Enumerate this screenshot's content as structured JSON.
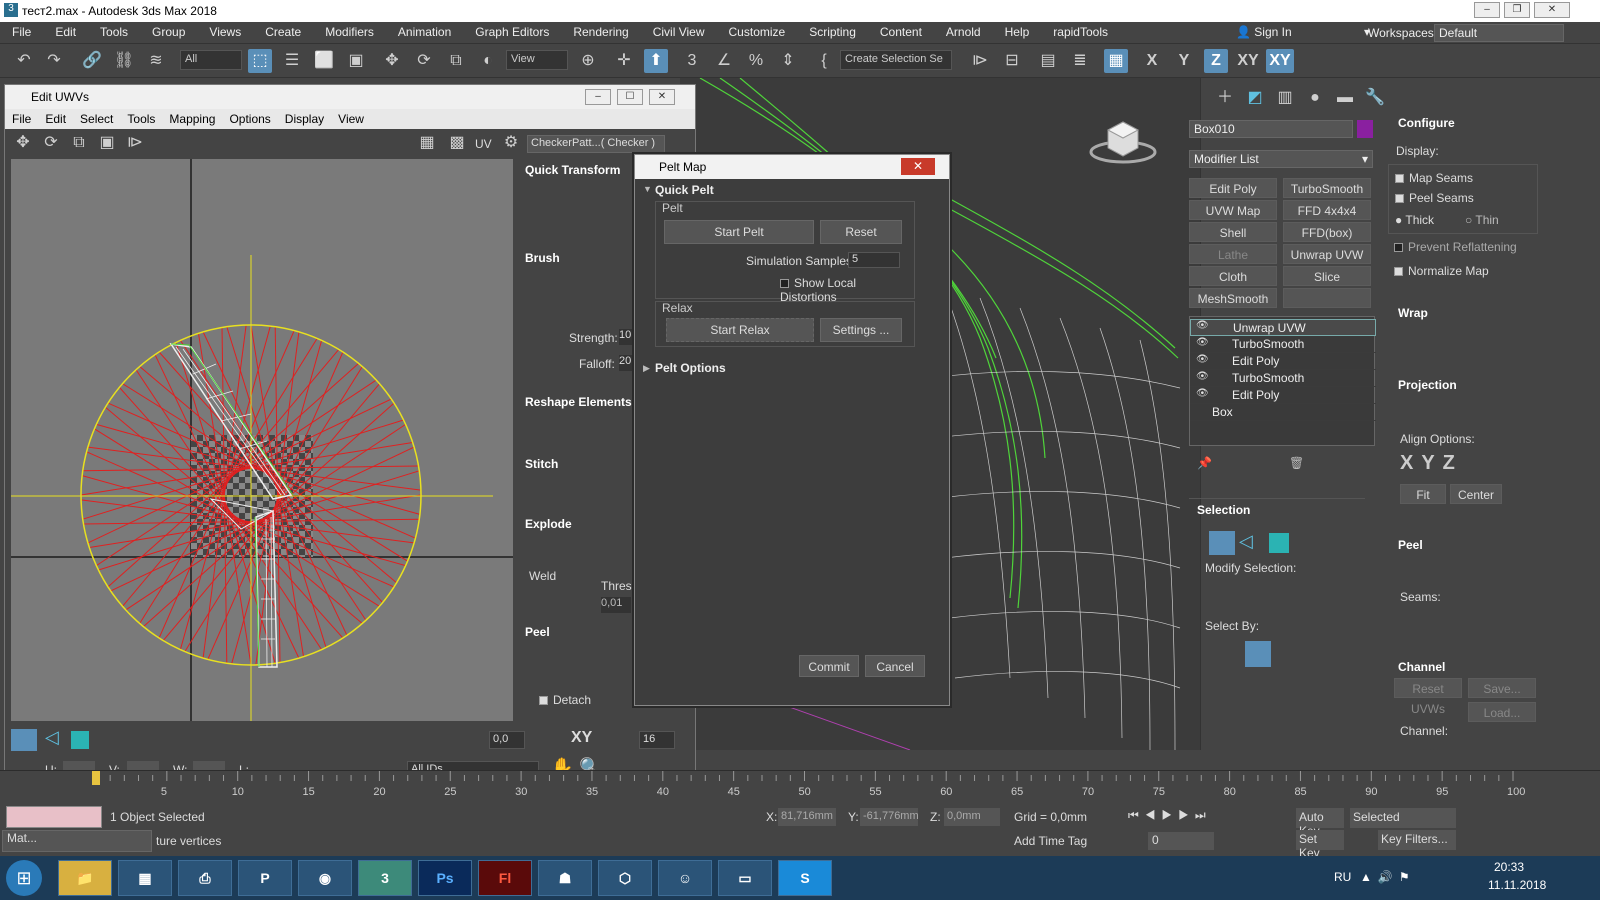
{
  "app": {
    "title": "тест2.max - Autodesk 3ds Max 2018",
    "menu": [
      "File",
      "Edit",
      "Tools",
      "Group",
      "Views",
      "Create",
      "Modifiers",
      "Animation",
      "Graph Editors",
      "Rendering",
      "Civil View",
      "Customize",
      "Scripting",
      "Content",
      "Arnold",
      "Help",
      "rapidTools"
    ],
    "sign_in": "Sign In",
    "workspaces_label": "Workspaces:",
    "workspace": "Default"
  },
  "toolbar": {
    "filter": "All",
    "view": "View",
    "selection_set": "Create Selection Se",
    "axes": [
      "X",
      "Y",
      "Z",
      "XY",
      "XY"
    ]
  },
  "uvw": {
    "title": "Edit UWVs",
    "menu": [
      "File",
      "Edit",
      "Select",
      "Tools",
      "Mapping",
      "Options",
      "Display",
      "View"
    ],
    "uv_label": "UV",
    "checker": "CheckerPatt...( Checker )",
    "sections": {
      "quick_transform": "Quick Transform",
      "brush": "Brush",
      "strength": "Strength:",
      "strength_val": "10",
      "falloff": "Falloff:",
      "falloff_val": "20",
      "reshape": "Reshape Elements",
      "stitch": "Stitch",
      "explode": "Explode",
      "weld": "Weld",
      "thresh": "Thresh",
      "thresh_val": "0,01",
      "peel": "Peel",
      "detach": "Detach"
    },
    "bottom": {
      "angle": "0,0",
      "xy": "XY",
      "count": "16",
      "u": "U:",
      "v": "V:",
      "w": "W:",
      "l": "L:",
      "ids": "All IDs"
    }
  },
  "pelt": {
    "title": "Pelt Map",
    "quick_pelt": "Quick Pelt",
    "pelt_group": "Pelt",
    "start_pelt": "Start Pelt",
    "reset": "Reset",
    "sim_samples_label": "Simulation Samples:",
    "sim_samples": "5",
    "show_distortions": "Show Local Distortions",
    "relax_group": "Relax",
    "start_relax": "Start Relax",
    "settings": "Settings ...",
    "pelt_options": "Pelt Options",
    "commit": "Commit",
    "cancel": "Cancel"
  },
  "cmd": {
    "object_name": "Box010",
    "modifier_list": "Modifier List",
    "buttons": [
      "Edit Poly",
      "TurboSmooth",
      "UVW Map",
      "FFD 4x4x4",
      "Shell",
      "FFD(box)",
      "Lathe",
      "Unwrap UVW",
      "Cloth",
      "Slice",
      "MeshSmooth"
    ],
    "stack": [
      "Unwrap UVW",
      "TurboSmooth",
      "Edit Poly",
      "TurboSmooth",
      "Edit Poly",
      "Box"
    ],
    "selection": "Selection",
    "modify_selection": "Modify Selection:",
    "select_by": "Select By:"
  },
  "configure": {
    "title": "Configure",
    "display": "Display:",
    "map_seams": "Map Seams",
    "peel_seams": "Peel Seams",
    "thick": "Thick",
    "thin": "Thin",
    "prevent": "Prevent Reflattening",
    "normalize": "Normalize Map",
    "wrap": "Wrap",
    "projection": "Projection",
    "align": "Align Options:",
    "fit": "Fit",
    "center": "Center",
    "peel": "Peel",
    "seams": "Seams:",
    "channel": "Channel",
    "reset_uvws": "Reset UVWs",
    "save": "Save...",
    "load": "Load...",
    "channel_label": "Channel:"
  },
  "timeline": {
    "ticks": [
      "5",
      "10",
      "15",
      "20",
      "25",
      "30",
      "35",
      "40",
      "45",
      "50",
      "55",
      "60",
      "65",
      "70",
      "75",
      "80",
      "85",
      "90",
      "95",
      "100"
    ]
  },
  "status": {
    "selected": "1 Object Selected",
    "x": "81,716mm",
    "y": "-61,776mm",
    "z": "0,0mm",
    "grid": "Grid = 0,0mm",
    "autokey": "Auto Key",
    "setkey": "Set Key",
    "sel_mode": "Selected",
    "keyfilters": "Key Filters...",
    "frame": "0",
    "add_time_tag": "Add Time Tag",
    "prompt": "ture vertices",
    "mat_tab": "Mat...",
    "x_label": "X:",
    "y_label": "Y:",
    "z_label": "Z:"
  },
  "taskbar": {
    "lang": "RU",
    "time": "20:33",
    "date": "11.11.2018"
  }
}
